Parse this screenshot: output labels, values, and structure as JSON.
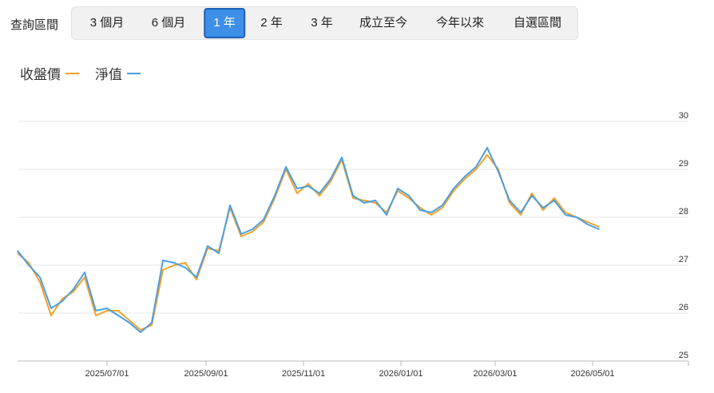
{
  "toolbar": {
    "query_label": "查詢區間",
    "buttons": [
      {
        "label": "3 個月",
        "active": false
      },
      {
        "label": "6 個月",
        "active": false
      },
      {
        "label": "1 年",
        "active": true
      },
      {
        "label": "2 年",
        "active": false
      },
      {
        "label": "3 年",
        "active": false
      },
      {
        "label": "成立至今",
        "active": false
      },
      {
        "label": "今年以來",
        "active": false
      },
      {
        "label": "自選區間",
        "active": false
      }
    ]
  },
  "colors": {
    "close_price": "#f5a128",
    "nav": "#4a9fe0",
    "active_button": "#3d8fe8"
  },
  "chart_data": {
    "type": "line",
    "title": "",
    "xlabel": "",
    "ylabel": "",
    "ylim": [
      25,
      30
    ],
    "yticks": [
      "30",
      "29",
      "28",
      "27",
      "26",
      "25"
    ],
    "xticks": [
      "2025/07/01",
      "2025/09/01",
      "2025/11/01",
      "2026/01/01",
      "2026/03/01",
      "2026/05/01"
    ],
    "xrange": [
      "2025/05/06",
      "2026/06/30"
    ],
    "grid": true,
    "legend_position": "top-left",
    "x": [
      "2025/05/06",
      "2025/05/13",
      "2025/05/20",
      "2025/05/27",
      "2025/06/03",
      "2025/06/10",
      "2025/06/17",
      "2025/06/24",
      "2025/07/01",
      "2025/07/08",
      "2025/07/15",
      "2025/07/22",
      "2025/07/29",
      "2025/08/05",
      "2025/08/12",
      "2025/08/19",
      "2025/08/26",
      "2025/09/02",
      "2025/09/09",
      "2025/09/16",
      "2025/09/23",
      "2025/09/30",
      "2025/10/07",
      "2025/10/14",
      "2025/10/21",
      "2025/10/28",
      "2025/11/04",
      "2025/11/11",
      "2025/11/18",
      "2025/11/25",
      "2025/12/02",
      "2025/12/09",
      "2025/12/16",
      "2025/12/23",
      "2025/12/30",
      "2026/01/06",
      "2026/01/13",
      "2026/01/20",
      "2026/01/27",
      "2026/02/03",
      "2026/02/10",
      "2026/02/17",
      "2026/02/24",
      "2026/03/03",
      "2026/03/10",
      "2026/03/17",
      "2026/03/24",
      "2026/03/31",
      "2026/04/07",
      "2026/04/14",
      "2026/04/21",
      "2026/04/28",
      "2026/05/05"
    ],
    "series": [
      {
        "name": "收盤價",
        "values": [
          27.25,
          27.05,
          26.65,
          25.95,
          26.3,
          26.45,
          26.75,
          25.95,
          26.05,
          26.05,
          25.85,
          25.65,
          25.75,
          26.9,
          27.0,
          27.05,
          26.7,
          27.35,
          27.3,
          28.2,
          27.6,
          27.7,
          27.9,
          28.4,
          29.0,
          28.5,
          28.7,
          28.45,
          28.75,
          29.2,
          28.4,
          28.35,
          28.3,
          28.1,
          28.55,
          28.4,
          28.2,
          28.05,
          28.2,
          28.55,
          28.8,
          29.0,
          29.3,
          29.0,
          28.3,
          28.05,
          28.5,
          28.15,
          28.4,
          28.1,
          28.0,
          27.9,
          27.8
        ]
      },
      {
        "name": "淨值",
        "values": [
          27.3,
          27.0,
          26.75,
          26.1,
          26.25,
          26.5,
          26.85,
          26.05,
          26.1,
          25.95,
          25.8,
          25.6,
          25.8,
          27.1,
          27.05,
          26.95,
          26.75,
          27.4,
          27.25,
          28.25,
          27.65,
          27.75,
          27.95,
          28.45,
          29.05,
          28.6,
          28.65,
          28.5,
          28.8,
          29.25,
          28.45,
          28.3,
          28.35,
          28.05,
          28.6,
          28.45,
          28.15,
          28.1,
          28.25,
          28.6,
          28.85,
          29.05,
          29.45,
          28.95,
          28.35,
          28.1,
          28.45,
          28.2,
          28.35,
          28.05,
          28.0,
          27.85,
          27.75
        ]
      }
    ]
  }
}
